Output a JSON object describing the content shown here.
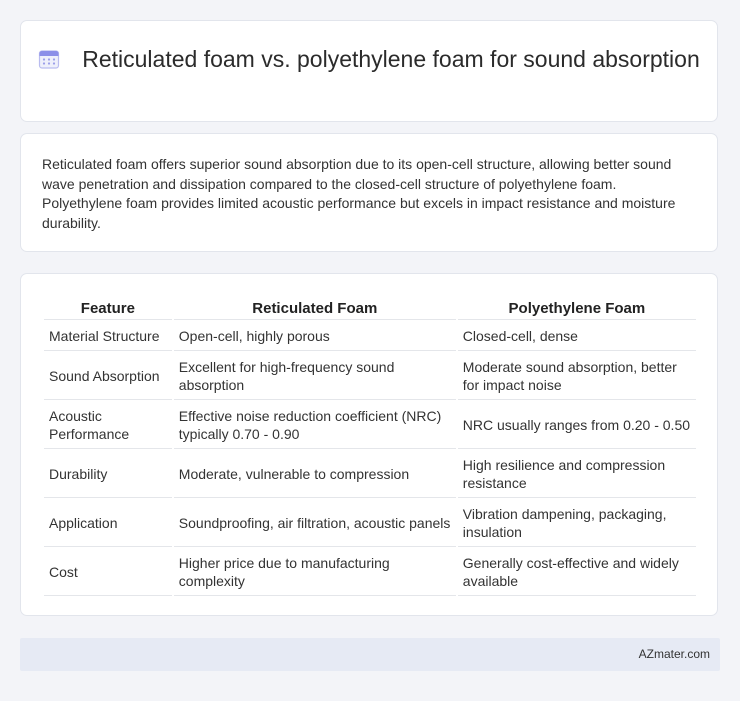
{
  "header": {
    "title_icon": "calendar-icon",
    "title": "Reticulated foam vs. polyethylene foam for sound absorption"
  },
  "summary": {
    "text": "Reticulated foam offers superior sound absorption due to its open-cell structure, allowing better sound wave penetration and dissipation compared to the closed-cell structure of polyethylene foam. Polyethylene foam provides limited acoustic performance but excels in impact resistance and moisture durability."
  },
  "table": {
    "headers": [
      "Feature",
      "Reticulated Foam",
      "Polyethylene Foam"
    ],
    "rows": [
      [
        "Material Structure",
        "Open-cell, highly porous",
        "Closed-cell, dense"
      ],
      [
        "Sound Absorption",
        "Excellent for high-frequency sound absorption",
        "Moderate sound absorption, better for impact noise"
      ],
      [
        "Acoustic Performance",
        "Effective noise reduction coefficient (NRC) typically 0.70 - 0.90",
        "NRC usually ranges from 0.20 - 0.50"
      ],
      [
        "Durability",
        "Moderate, vulnerable to compression",
        "High resilience and compression resistance"
      ],
      [
        "Application",
        "Soundproofing, air filtration, acoustic panels",
        "Vibration dampening, packaging, insulation"
      ],
      [
        "Cost",
        "Higher price due to manufacturing complexity",
        "Generally cost-effective and widely available"
      ]
    ]
  },
  "footer": {
    "site": "AZmater.com"
  },
  "colors": {
    "page_background": "#f3f4f8",
    "card_background": "#ffffff",
    "footer_background": "#e6eaf4",
    "icon_accent": "#8b8fe8"
  }
}
